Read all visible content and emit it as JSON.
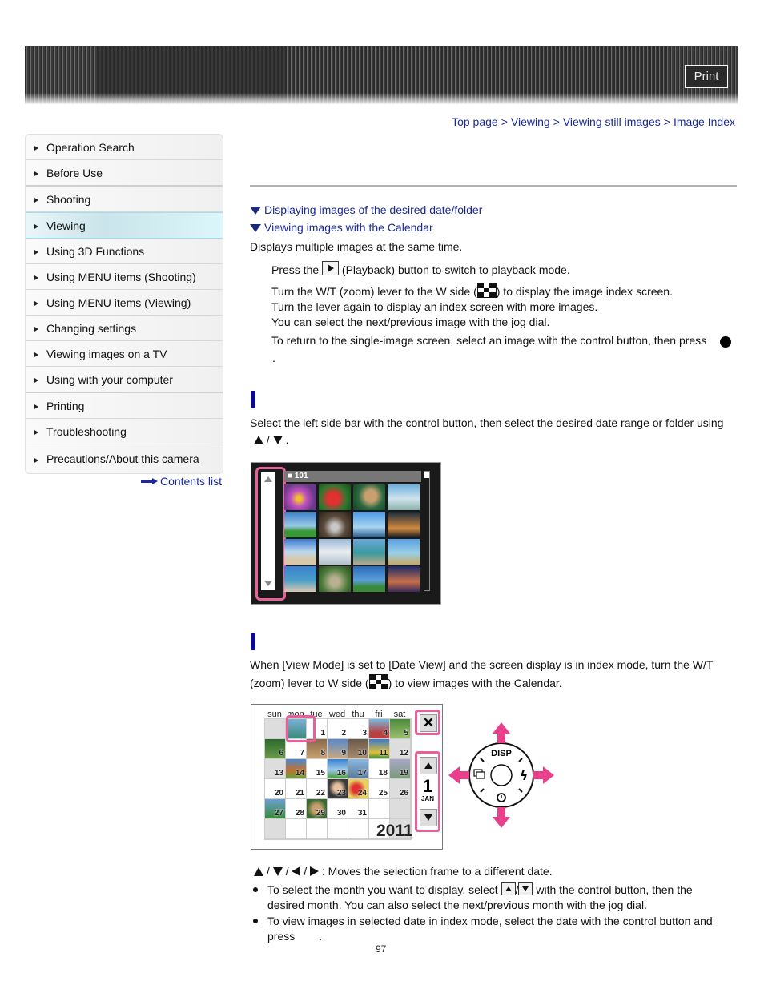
{
  "header": {
    "print_label": "Print"
  },
  "breadcrumb": [
    {
      "label": "Top page"
    },
    {
      "label": "Viewing"
    },
    {
      "label": "Viewing still images"
    },
    {
      "label": "Image Index"
    }
  ],
  "breadcrumb_separator": ">",
  "sidebar": {
    "items": [
      {
        "label": "Operation Search"
      },
      {
        "label": "Before Use"
      },
      {
        "label": "Shooting"
      },
      {
        "label": "Viewing",
        "active": true
      },
      {
        "label": "Using 3D Functions"
      },
      {
        "label": "Using MENU items (Shooting)"
      },
      {
        "label": "Using MENU items (Viewing)"
      },
      {
        "label": "Changing settings"
      },
      {
        "label": "Viewing images on a TV"
      },
      {
        "label": "Using with your computer"
      },
      {
        "label": "Printing"
      },
      {
        "label": "Troubleshooting"
      },
      {
        "label": "Precautions/About this camera"
      }
    ],
    "contents_link": "Contents list"
  },
  "main": {
    "toc": [
      {
        "label": "Displaying images of the desired date/folder"
      },
      {
        "label": "Viewing images with the Calendar"
      }
    ],
    "intro": "Displays multiple images at the same time.",
    "step1_pre": "Press the",
    "step1_post": "(Playback) button to switch to playback mode.",
    "step2_pre": "Turn the W/T (zoom) lever to the W side (",
    "step2_post": ") to display the image index screen.",
    "step2_line2": "Turn the lever again to display an index screen with more images.",
    "step2_line3": "You can select the next/previous image with the jog dial.",
    "step3": "To return to the single-image screen, select an image with the control button, then press",
    "step3_end": ".",
    "section1": {
      "text": "Select the left side bar with the control button, then select the desired date range or folder using",
      "sep": "/",
      "end": "."
    },
    "index_screen": {
      "folder": "101"
    },
    "section2": {
      "text_line1": "When [View Mode] is set to [Date View] and the screen display is in index mode, turn the W/T",
      "text_line2_pre": "(zoom) lever to W side (",
      "text_line2_post": ") to view images with the Calendar."
    },
    "calendar": {
      "weekdays": [
        "sun",
        "mon",
        "tue",
        "wed",
        "thu",
        "fri",
        "sat"
      ],
      "days": [
        "",
        "",
        "1",
        "2",
        "3",
        "4",
        "5",
        "6",
        "7",
        "8",
        "9",
        "10",
        "11",
        "12",
        "13",
        "14",
        "15",
        "16",
        "17",
        "18",
        "19",
        "20",
        "21",
        "22",
        "23",
        "24",
        "25",
        "26",
        "27",
        "28",
        "29",
        "30",
        "31",
        "",
        "",
        "",
        "",
        "",
        "",
        "",
        "",
        ""
      ],
      "selected_day": "1",
      "month_day": "1",
      "month": "JAN",
      "year": "2011",
      "close_label": "✕"
    },
    "dial": {
      "top_label": "DISP"
    },
    "moves_sep": "/",
    "moves_text": ": Moves the selection frame to a different date.",
    "bullet1_pre": "To select the month you want to display, select",
    "bullet1_sep": "/",
    "bullet1_post": "with the control button, then the",
    "bullet1_line2": "desired month. You can also select the next/previous month with the jog dial.",
    "bullet2_line1": "To view images in selected date in index mode, select the date with the control button and",
    "bullet2_line2": "press",
    "bullet2_end": "."
  },
  "footer": {
    "page_number": "97"
  },
  "colors": {
    "link": "#1a2a9a",
    "section_bar": "#0a0a8a",
    "highlight": "#e8609a",
    "active_item": "#c9e4ea"
  }
}
